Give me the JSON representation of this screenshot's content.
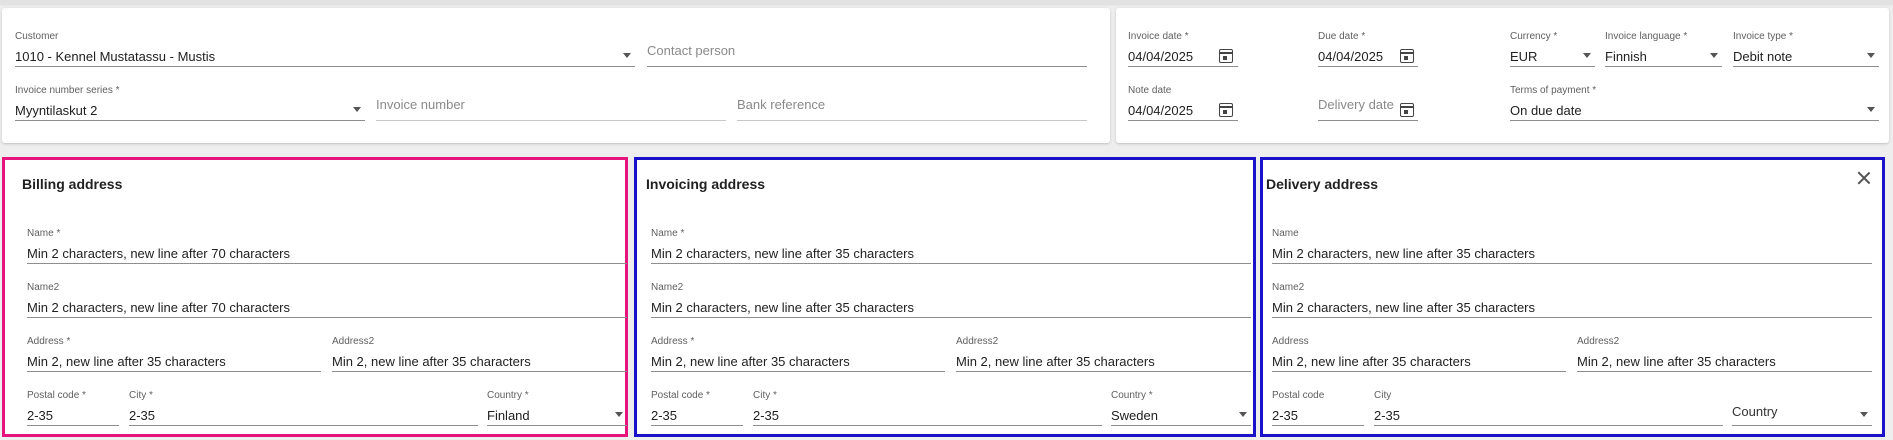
{
  "header": {
    "customer": {
      "label": "Customer",
      "value": "1010 - Kennel Mustatassu - Mustis"
    },
    "contact_person": {
      "placeholder": "Contact person"
    },
    "invoice_number_series": {
      "label": "Invoice number series *",
      "value": "Myyntilaskut 2"
    },
    "invoice_number": {
      "placeholder": "Invoice number"
    },
    "bank_reference": {
      "placeholder": "Bank reference"
    },
    "invoice_date": {
      "label": "Invoice date *",
      "value": "04/04/2025"
    },
    "due_date": {
      "label": "Due date *",
      "value": "04/04/2025"
    },
    "currency": {
      "label": "Currency *",
      "value": "EUR"
    },
    "invoice_language": {
      "label": "Invoice language *",
      "value": "Finnish"
    },
    "invoice_type": {
      "label": "Invoice type *",
      "value": "Debit note"
    },
    "note_date": {
      "label": "Note date",
      "value": "04/04/2025"
    },
    "delivery_date": {
      "placeholder": "Delivery date"
    },
    "terms_of_payment": {
      "label": "Terms of payment *",
      "value": "On due date"
    }
  },
  "billing": {
    "title": "Billing address",
    "name": {
      "label": "Name *",
      "value": "Min 2 characters, new line after 70 characters"
    },
    "name2": {
      "label": "Name2",
      "value": "Min 2 characters, new line after 70 characters"
    },
    "address": {
      "label": "Address *",
      "value": "Min 2, new line after 35 characters"
    },
    "address2": {
      "label": "Address2",
      "value": "Min 2, new line after 35 characters"
    },
    "postal_code": {
      "label": "Postal code *",
      "value": "2-35"
    },
    "city": {
      "label": "City *",
      "value": "2-35"
    },
    "country": {
      "label": "Country *",
      "value": "Finland"
    },
    "border_color": "#e6157d"
  },
  "invoicing": {
    "title": "Invoicing address",
    "name": {
      "label": "Name *",
      "value": "Min 2 characters, new line after 35 characters"
    },
    "name2": {
      "label": "Name2",
      "value": "Min 2 characters, new line after 35 characters"
    },
    "address": {
      "label": "Address *",
      "value": "Min 2, new line after 35 characters"
    },
    "address2": {
      "label": "Address2",
      "value": "Min 2, new line after 35 characters"
    },
    "postal_code": {
      "label": "Postal code *",
      "value": "2-35"
    },
    "city": {
      "label": "City *",
      "value": "2-35"
    },
    "country": {
      "label": "Country *",
      "value": "Sweden"
    },
    "border_color": "#1a12c8"
  },
  "delivery": {
    "title": "Delivery address",
    "name": {
      "label": "Name",
      "value": "Min 2 characters, new line after 35 characters"
    },
    "name2": {
      "label": "Name2",
      "value": "Min 2 characters, new line after 35 characters"
    },
    "address": {
      "label": "Address",
      "value": "Min 2, new line after 35 characters"
    },
    "address2": {
      "label": "Address2",
      "value": "Min 2, new line after 35 characters"
    },
    "postal_code": {
      "label": "Postal code",
      "value": "2-35"
    },
    "city": {
      "label": "City",
      "value": "2-35"
    },
    "country": {
      "placeholder": "Country"
    },
    "close_icon": "close-icon",
    "border_color": "#1a12c8"
  },
  "icons": {
    "dropdown": "chevron-down-icon",
    "calendar": "calendar-icon"
  }
}
